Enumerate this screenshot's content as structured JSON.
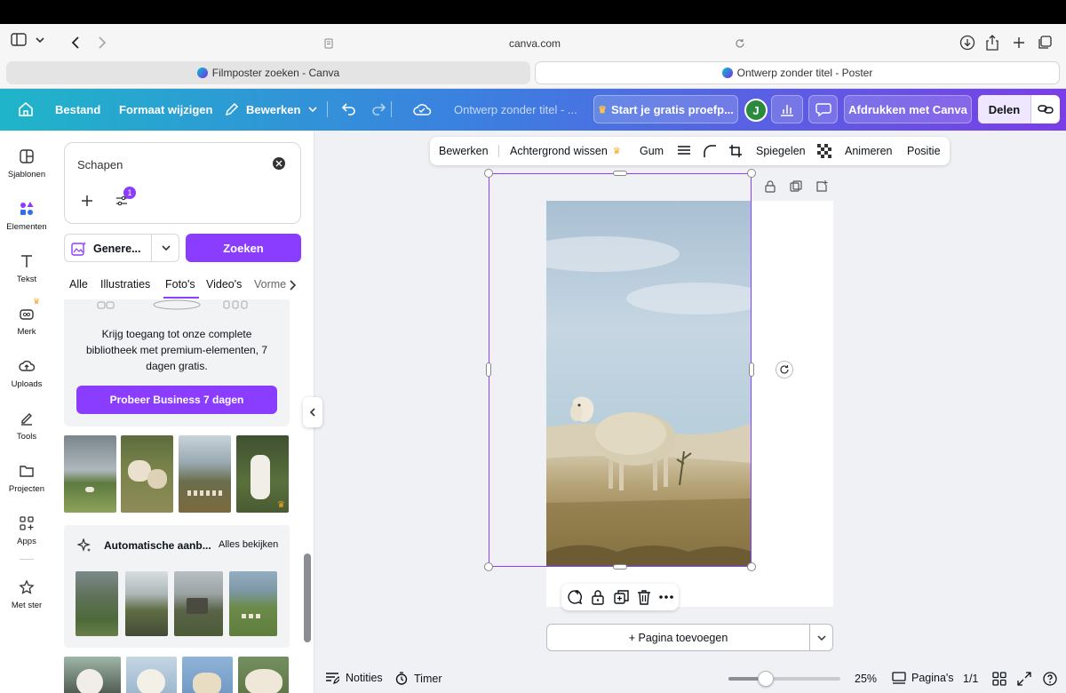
{
  "browser": {
    "url": "canva.com",
    "tabs": [
      {
        "label": "Filmposter zoeken - Canva",
        "active": false
      },
      {
        "label": "Ontwerp zonder titel - Poster",
        "active": true
      }
    ]
  },
  "header": {
    "menu": [
      "Bestand",
      "Formaat wijzigen",
      "Bewerken"
    ],
    "doc_title": "Ontwerp zonder titel - ...",
    "trial": "Start je gratis proefp...",
    "avatar_letter": "J",
    "print": "Afdrukken met Canva",
    "share": "Delen"
  },
  "sidebar": {
    "items": [
      {
        "label": "Sjablonen",
        "icon": "template-icon"
      },
      {
        "label": "Elementen",
        "icon": "elements-icon"
      },
      {
        "label": "Tekst",
        "icon": "text-icon"
      },
      {
        "label": "Merk",
        "icon": "brand-icon"
      },
      {
        "label": "Uploads",
        "icon": "upload-icon"
      },
      {
        "label": "Tools",
        "icon": "pen-icon"
      },
      {
        "label": "Projecten",
        "icon": "folder-icon"
      },
      {
        "label": "Apps",
        "icon": "apps-icon"
      },
      {
        "label": "Met ster",
        "icon": "star-icon"
      }
    ]
  },
  "panel": {
    "search_value": "Schapen",
    "filter_badge": "1",
    "generate_label": "Genere...",
    "search_button": "Zoeken",
    "tabs": [
      "Alle",
      "Illustraties",
      "Foto's",
      "Video's",
      "Vorme"
    ],
    "promo_text": "Krijg toegang tot onze complete bibliotheek met premium-elementen, 7 dagen gratis.",
    "promo_button": "Probeer Business 7 dagen",
    "auto_title": "Automatische aanb...",
    "see_all": "Alles bekijken"
  },
  "context_toolbar": {
    "edit": "Bewerken",
    "remove_bg": "Achtergrond wissen",
    "eraser": "Gum",
    "flip": "Spiegelen",
    "animate": "Animeren",
    "position": "Positie"
  },
  "canvas": {
    "add_page": "+ Pagina toevoegen"
  },
  "bottom": {
    "notes": "Notities",
    "timer": "Timer",
    "zoom": "25%",
    "zoom_fraction": 0.06,
    "pages_label": "Pagina's",
    "page_count": "1/1"
  },
  "colors": {
    "accent": "#8b3dff",
    "header_start": "#1fb5c9",
    "header_end": "#7a3ee6"
  }
}
